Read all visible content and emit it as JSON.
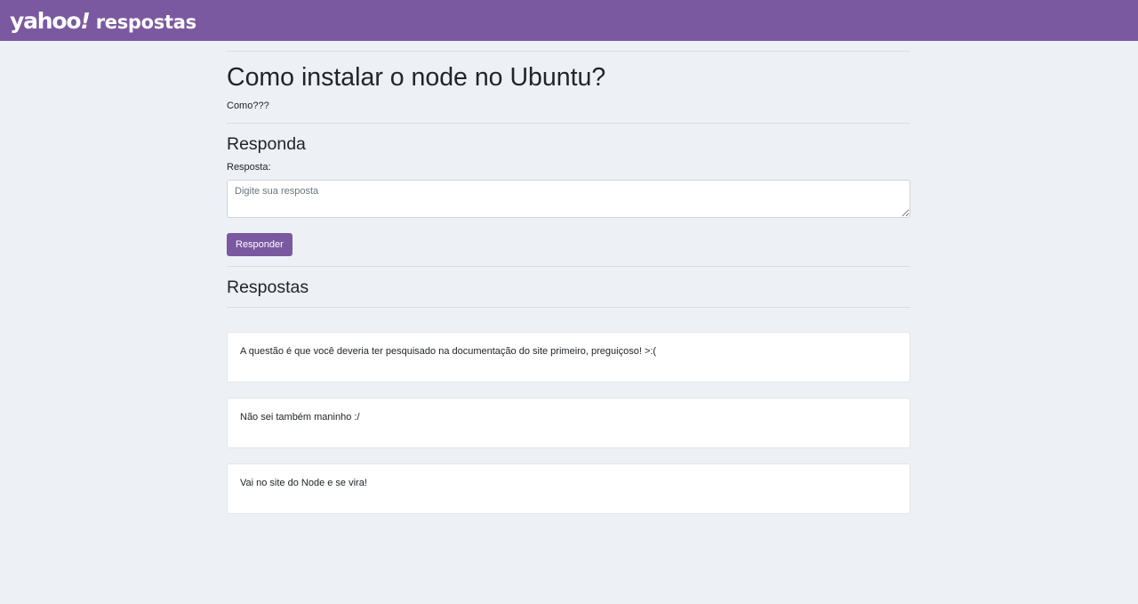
{
  "navbar": {
    "logo_main": "yahoo",
    "logo_bang": "!",
    "logo_product": "respostas",
    "background_color": "#7b59a0"
  },
  "question": {
    "title": "Como instalar o node no Ubuntu?",
    "body": "Como???"
  },
  "respond": {
    "title": "Responda",
    "label": "Resposta:",
    "placeholder": "Digite sua resposta",
    "value": "",
    "button_label": "Responder"
  },
  "answers": {
    "title": "Respostas",
    "items": [
      {
        "text": "A questão é que você deveria ter pesquisado na documentação do site primeiro, preguiçoso! >:("
      },
      {
        "text": "Não sei também maninho :/"
      },
      {
        "text": "Vai no site do Node e se vira!"
      }
    ]
  }
}
